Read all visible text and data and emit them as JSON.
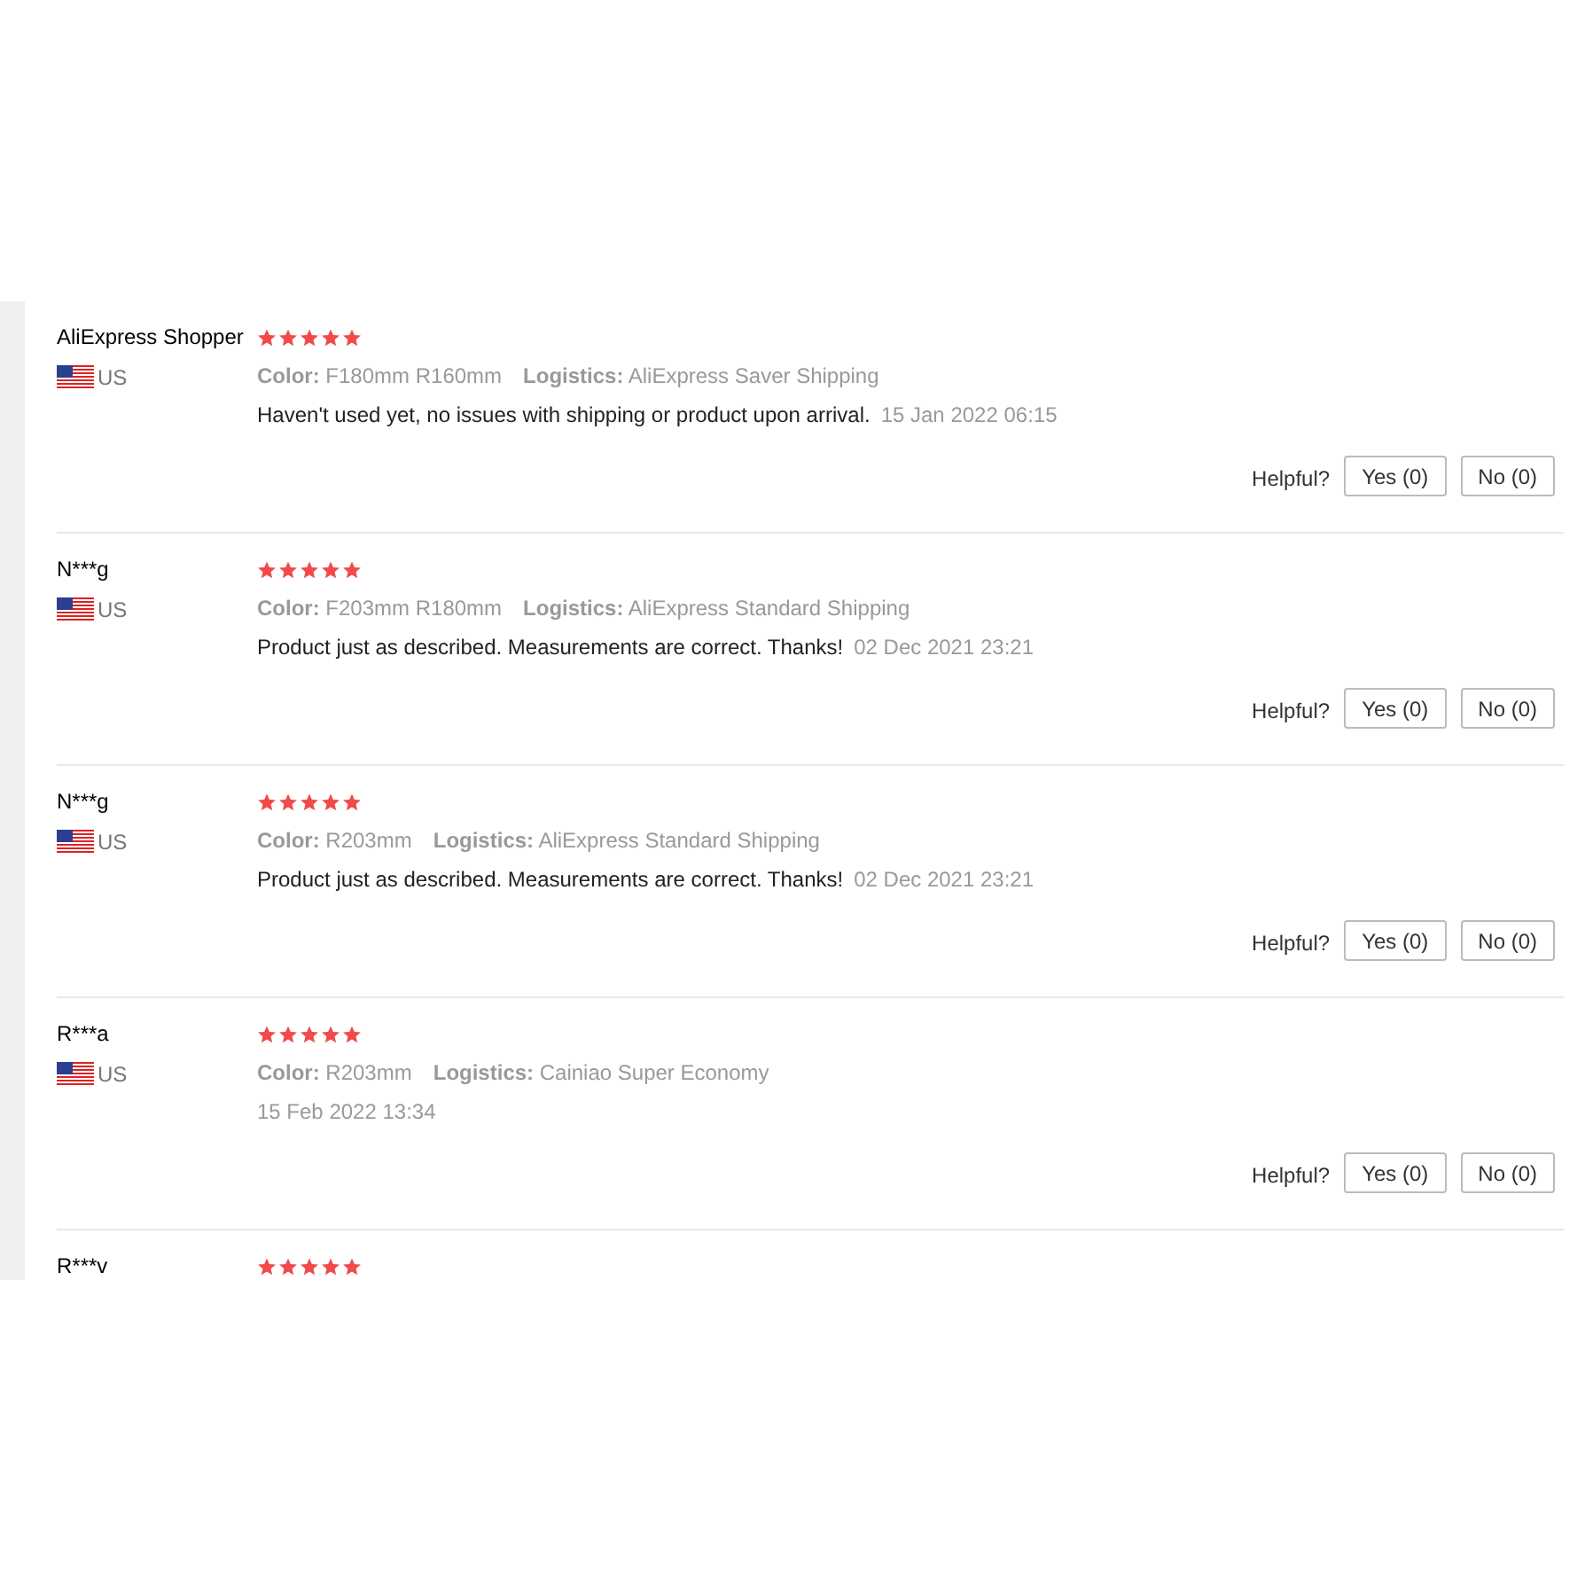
{
  "reviews": [
    {
      "name": "AliExpress Shopper",
      "country": "US",
      "stars": 5,
      "color_label": "Color:",
      "color_value": "F180mm R160mm",
      "logistics_label": "Logistics:",
      "logistics": "AliExpress Saver Shipping",
      "text": "Haven't used yet, no issues with shipping or product upon arrival.",
      "date": "15 Jan 2022 06:15",
      "helpful": "Helpful?",
      "yes": "Yes (0)",
      "no": "No (0)"
    },
    {
      "name": "N***g",
      "country": "US",
      "stars": 5,
      "color_label": "Color:",
      "color_value": "F203mm R180mm",
      "logistics_label": "Logistics:",
      "logistics": "AliExpress Standard Shipping",
      "text": "Product just as described. Measurements are correct. Thanks!",
      "date": "02 Dec 2021 23:21",
      "helpful": "Helpful?",
      "yes": "Yes (0)",
      "no": "No (0)"
    },
    {
      "name": "N***g",
      "country": "US",
      "stars": 5,
      "color_label": "Color:",
      "color_value": "R203mm",
      "logistics_label": "Logistics:",
      "logistics": "AliExpress Standard Shipping",
      "text": "Product just as described. Measurements are correct. Thanks!",
      "date": "02 Dec 2021 23:21",
      "helpful": "Helpful?",
      "yes": "Yes (0)",
      "no": "No (0)"
    },
    {
      "name": "R***a",
      "country": "US",
      "stars": 5,
      "color_label": "Color:",
      "color_value": "R203mm",
      "logistics_label": "Logistics:",
      "logistics": "Cainiao Super Economy",
      "date": "15 Feb 2022 13:34",
      "helpful": "Helpful?",
      "yes": "Yes (0)",
      "no": "No (0)"
    },
    {
      "name": "R***v",
      "stars": 5
    }
  ]
}
